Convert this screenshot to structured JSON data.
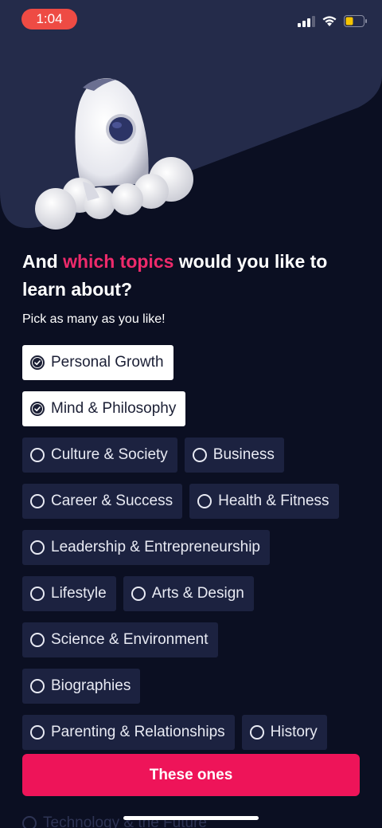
{
  "status": {
    "time": "1:04"
  },
  "onboarding": {
    "question_start": "And ",
    "question_accent": "which topics",
    "question_end": " would you like to learn about?",
    "subtitle": "Pick as many as you like!",
    "rows": [
      [
        {
          "label": "Personal Growth",
          "selected": true
        }
      ],
      [
        {
          "label": "Mind & Philosophy",
          "selected": true
        }
      ],
      [
        {
          "label": "Culture & Society",
          "selected": false
        },
        {
          "label": "Business",
          "selected": false
        }
      ],
      [
        {
          "label": "Career & Success",
          "selected": false
        },
        {
          "label": "Health & Fitness",
          "selected": false
        }
      ],
      [
        {
          "label": "Leadership & Entrepreneurship",
          "selected": false
        }
      ],
      [
        {
          "label": "Lifestyle",
          "selected": false
        },
        {
          "label": "Arts & Design",
          "selected": false
        }
      ],
      [
        {
          "label": "Science & Environment",
          "selected": false
        }
      ],
      [
        {
          "label": "Biographies",
          "selected": false
        }
      ],
      [
        {
          "label": "Parenting & Relationships",
          "selected": false
        },
        {
          "label": "History",
          "selected": false
        }
      ]
    ],
    "partially_hidden_topic": "Technology & the Future",
    "cta_label": "These ones"
  },
  "colors": {
    "background": "#0b0f22",
    "hero_panel": "#242b4a",
    "accent": "#ee2a6b",
    "cta": "#ee1459",
    "chip": "#1c2240",
    "time_pill": "#ee4b44"
  }
}
